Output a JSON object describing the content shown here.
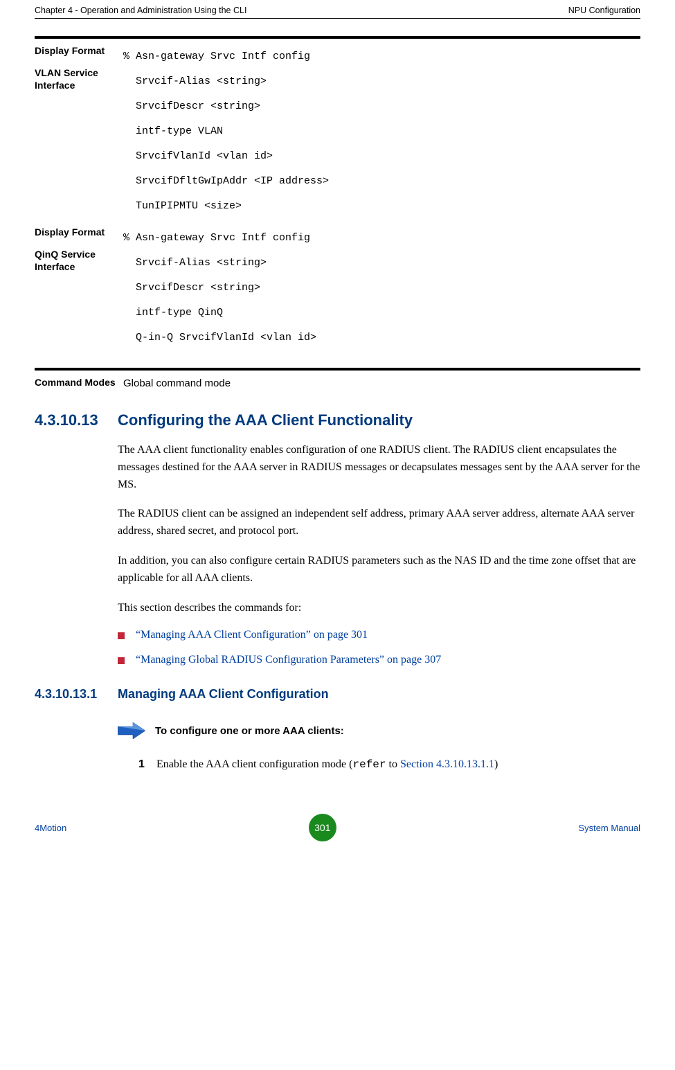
{
  "header": {
    "left": "Chapter 4 - Operation and Administration Using the CLI",
    "right": "NPU Configuration"
  },
  "blocks": {
    "displayVlan": {
      "label1": "Display Format",
      "label2": "VLAN Service Interface",
      "line1": "% Asn-gateway Srvc Intf config",
      "line2": "  Srvcif-Alias <string>",
      "line3": "  SrvcifDescr <string>",
      "line4": "  intf-type VLAN",
      "line5": "  SrvcifVlanId <vlan id>",
      "line6": "  SrvcifDfltGwIpAddr <IP address>",
      "line7": "  TunIPIPMTU <size>"
    },
    "displayQinQ": {
      "label1": "Display Format",
      "label2": "QinQ Service Interface",
      "line1": "% Asn-gateway Srvc Intf config",
      "line2": "  Srvcif-Alias <string>",
      "line3": "  SrvcifDescr <string>",
      "line4": "  intf-type QinQ",
      "line5": "  Q-in-Q SrvcifVlanId <vlan id>"
    },
    "commandModes": {
      "label": "Command Modes",
      "value": "Global command mode"
    }
  },
  "section": {
    "num": "4.3.10.13",
    "title": "Configuring the AAA Client Functionality",
    "para1": "The AAA client functionality enables configuration of one RADIUS client. The RADIUS client encapsulates the messages destined for the AAA server in RADIUS messages or decapsulates messages sent by the AAA server for the MS.",
    "para2": "The RADIUS client can be assigned an independent self address, primary AAA server address, alternate AAA server address, shared secret, and protocol port.",
    "para3": "In addition, you can also configure certain RADIUS parameters such as the NAS ID and the time zone offset that are applicable for all AAA clients.",
    "para4": "This section describes the commands for:",
    "bullet1": "“Managing AAA Client Configuration” on page 301",
    "bullet2": "“Managing Global RADIUS Configuration Parameters” on page 307"
  },
  "subsection": {
    "num": "4.3.10.13.1",
    "title": "Managing AAA Client Configuration",
    "procTitle": "To configure one or more AAA clients:",
    "step1": {
      "num": "1",
      "pre": "Enable the AAA client configuration mode (",
      "mono": "refer",
      "mid": " to ",
      "link": "Section 4.3.10.13.1.1",
      "post": ")"
    }
  },
  "footer": {
    "left": "4Motion",
    "page": "301",
    "right": "System Manual"
  }
}
